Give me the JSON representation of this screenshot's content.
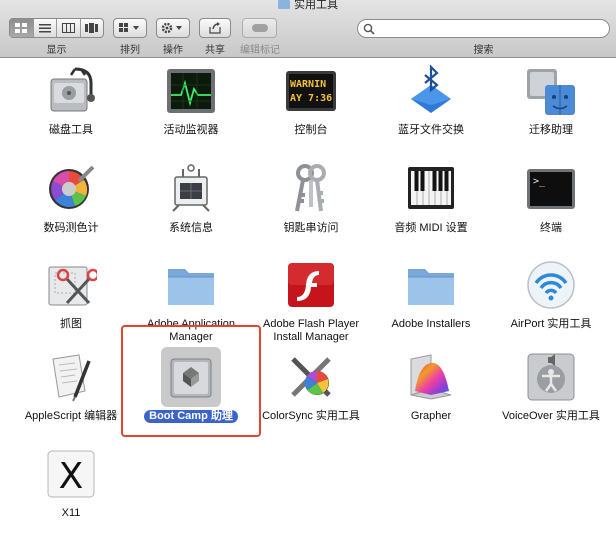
{
  "window": {
    "title": "实用工具"
  },
  "toolbar": {
    "view_label": "显示",
    "arrange_label": "排列",
    "action_label": "操作",
    "share_label": "共享",
    "edit_tags_label": "编辑标记",
    "search_label": "搜索",
    "search_value": ""
  },
  "apps": [
    {
      "name": "磁盘工具",
      "icon": "disk-utility-icon"
    },
    {
      "name": "活动监视器",
      "icon": "activity-monitor-icon"
    },
    {
      "name": "控制台",
      "icon": "console-icon",
      "icon_text": [
        "WARNIN",
        "AY 7:36"
      ]
    },
    {
      "name": "蓝牙文件交换",
      "icon": "bluetooth-icon"
    },
    {
      "name": "迁移助理",
      "icon": "migration-assistant-icon"
    },
    {
      "name": "数码测色计",
      "icon": "digital-color-meter-icon"
    },
    {
      "name": "系统信息",
      "icon": "system-information-icon"
    },
    {
      "name": "钥匙串访问",
      "icon": "keychain-icon"
    },
    {
      "name": "音频 MIDI 设置",
      "icon": "audio-midi-icon"
    },
    {
      "name": "终端",
      "icon": "terminal-icon",
      "icon_text": ">_"
    },
    {
      "name": "抓图",
      "icon": "grab-icon"
    },
    {
      "name": [
        "Adobe Application",
        "Manager"
      ],
      "icon": "folder-icon"
    },
    {
      "name": [
        "Adobe Flash Player",
        "Install Manager"
      ],
      "icon": "flash-icon"
    },
    {
      "name": "Adobe Installers",
      "icon": "folder-icon"
    },
    {
      "name": "AirPort 实用工具",
      "icon": "airport-icon"
    },
    {
      "name": "AppleScript 编辑器",
      "icon": "applescript-icon"
    },
    {
      "name": "Boot Camp 助理",
      "icon": "bootcamp-icon",
      "selected": true
    },
    {
      "name": "ColorSync 实用工具",
      "icon": "colorsync-icon"
    },
    {
      "name": "Grapher",
      "icon": "grapher-icon"
    },
    {
      "name": "VoiceOver 实用工具",
      "icon": "voiceover-icon"
    },
    {
      "name": "X11",
      "icon": "x11-icon",
      "icon_text": "X"
    }
  ],
  "colors": {
    "selection": "#3b63c9",
    "highlight_box": "#e6432e"
  }
}
